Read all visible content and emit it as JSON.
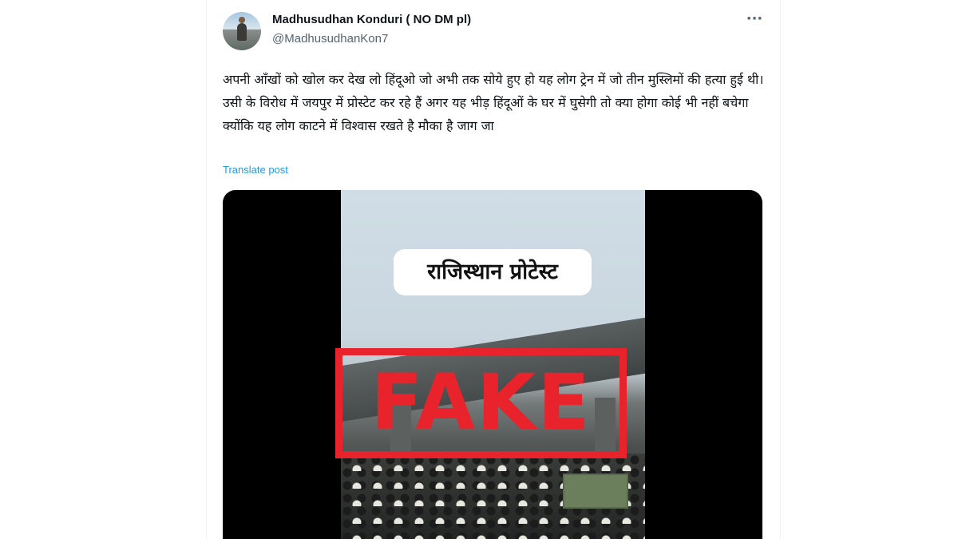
{
  "post": {
    "author_name": "Madhusudhan Konduri ( NO DM pl)",
    "author_handle": "@MadhusudhanKon7",
    "more_icon": "more-horizontal-icon",
    "body_text": "अपनी आँखों को खोल कर देख लो हिंदूओ जो अभी तक सोये हुए हो यह लोग ट्रेन में जो तीन मुस्लिमों की हत्या हुई थी। उसी के विरोध में जयपुर में प्रोस्टेट कर रहे हैं अगर यह भीड़ हिंदूओं के घर में घुसेगी तो क्या होगा कोई भी नहीं बचेगा क्योंकि यह लोग काटने में विश्वास रखते है मौका है जाग जा",
    "translate_label": "Translate post"
  },
  "media": {
    "video_caption": "राजिस्थान प्रोटेस्ट",
    "overlay_stamp": "FAKE",
    "stamp_color": "#e8232b"
  },
  "colors": {
    "link": "#1d9bf0",
    "secondary_text": "#536471",
    "primary_text": "#0f1419"
  }
}
